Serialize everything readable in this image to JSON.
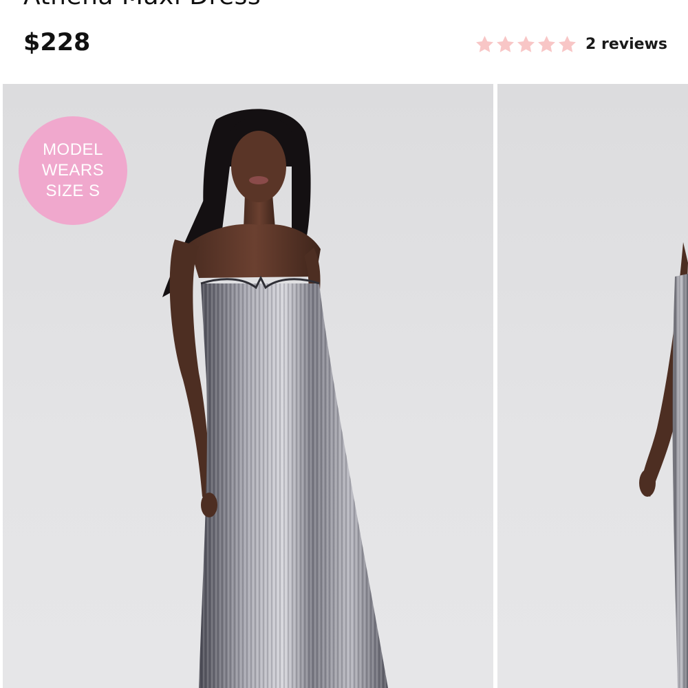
{
  "product": {
    "title": "Athena Maxi Dress",
    "price": "$228",
    "rating": {
      "value": 5,
      "max": 5,
      "reviews_label": "2 reviews",
      "star_color": "#f8c6c6"
    }
  },
  "gallery": {
    "badge": {
      "line1": "MODEL",
      "line2": "WEARS",
      "line3": "SIZE S",
      "color": "#f0a8cd"
    },
    "images": [
      {
        "name": "model-front-photo"
      },
      {
        "name": "model-side-photo"
      }
    ]
  }
}
